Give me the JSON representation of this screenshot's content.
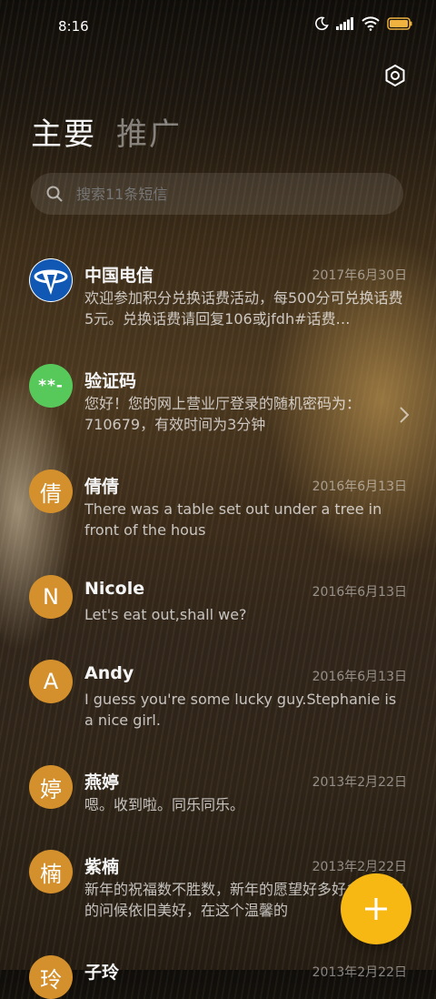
{
  "status_bar": {
    "time": "8:16",
    "icons": [
      "moon-icon",
      "signal-icon",
      "wifi-icon",
      "battery-icon"
    ]
  },
  "header": {
    "settings_icon": "gear-icon",
    "tabs": [
      {
        "label": "主要",
        "active": true
      },
      {
        "label": "推广",
        "active": false
      }
    ]
  },
  "search": {
    "placeholder": "搜索11条短信"
  },
  "conversations": [
    {
      "name": "中国电信",
      "date": "2017年6月30日",
      "snippet": "欢迎参加积分兑换话费活动，每500分可兑换话费5元。兑换话费请回复106或jfdh#话费…",
      "avatar_text": "",
      "avatar_type": "telecom-logo",
      "avatar_color": "#ffffff"
    },
    {
      "name": "验证码",
      "date": "",
      "snippet": "您好！您的网上营业厅登录的随机密码为：710679，有效时间为3分钟",
      "avatar_text": "**-",
      "avatar_type": "text",
      "avatar_color": "#57c95a"
    },
    {
      "name": "倩倩",
      "date": "2016年6月13日",
      "snippet": "There was a table set out under a tree in front of the hous",
      "avatar_text": "倩",
      "avatar_type": "text",
      "avatar_color": "#d4902c"
    },
    {
      "name": "Nicole",
      "date": "2016年6月13日",
      "snippet": "Let's eat out,shall we?",
      "avatar_text": "N",
      "avatar_type": "text",
      "avatar_color": "#d4902c"
    },
    {
      "name": "Andy",
      "date": "2016年6月13日",
      "snippet": "I guess you're some lucky guy.Stephanie is a nice girl.",
      "avatar_text": "A",
      "avatar_type": "text",
      "avatar_color": "#d4902c"
    },
    {
      "name": "燕婷",
      "date": "2013年2月22日",
      "snippet": "嗯。收到啦。同乐同乐。",
      "avatar_text": "婷",
      "avatar_type": "text",
      "avatar_color": "#d4902c"
    },
    {
      "name": "紫楠",
      "date": "2013年2月22日",
      "snippet": "新年的祝福数不胜数，新年的愿望好多好多，新年的问候依旧美好，在这个温馨的",
      "avatar_text": "楠",
      "avatar_type": "text",
      "avatar_color": "#d4902c"
    },
    {
      "name": "子玲",
      "date": "2013年2月22日",
      "snippet": "",
      "avatar_text": "玲",
      "avatar_type": "text",
      "avatar_color": "#d4902c"
    }
  ],
  "fab": {
    "icon": "plus-icon",
    "color": "#f8b814"
  }
}
